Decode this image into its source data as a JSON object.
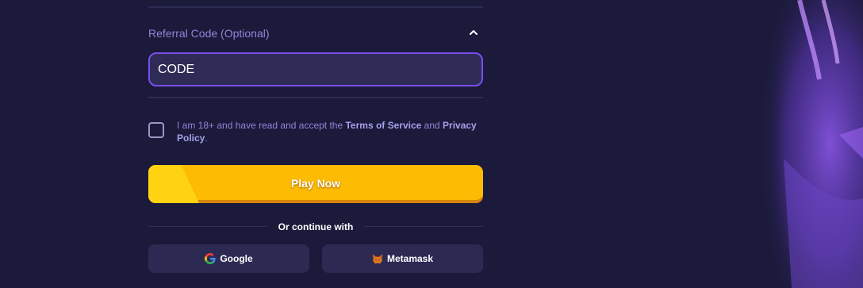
{
  "referral": {
    "label": "Referral Code (Optional)",
    "value": "CODE",
    "expanded": true
  },
  "consent": {
    "checked": false,
    "text_before": "I am 18+ and have read and accept the ",
    "terms_link": "Terms of Service",
    "text_and": " and ",
    "privacy_link": "Privacy Policy",
    "text_end": "."
  },
  "play_button": {
    "label": "Play Now"
  },
  "social": {
    "divider_text": "Or continue with",
    "google_label": "Google",
    "metamask_label": "Metamask"
  },
  "colors": {
    "background": "#1b1a3b",
    "accent_purple": "#7a4ff0",
    "button_yellow": "#fdbb04"
  }
}
